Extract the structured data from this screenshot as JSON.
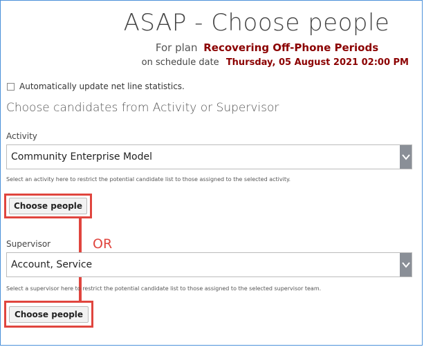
{
  "header": {
    "title": "ASAP - Choose people",
    "plan_prefix": "For plan",
    "plan_name": "Recovering Off-Phone Periods",
    "date_prefix": "on schedule date",
    "date_value": "Thursday, 05 August 2021 02:00 PM"
  },
  "options": {
    "auto_update_label": "Automatically update net line statistics.",
    "auto_update_checked": false
  },
  "main": {
    "section_heading": "Choose candidates from Activity or Supervisor",
    "or_label": "OR",
    "activity": {
      "label": "Activity",
      "selected": "Community Enterprise Model",
      "help": "Select an activity here to restrict the potential candidate list to those assigned to the selected activity.",
      "button": "Choose people"
    },
    "supervisor": {
      "label": "Supervisor",
      "selected": "Account, Service",
      "help": "Select a supervisor here to restrict the potential candidate list to those assigned to the selected supervisor team.",
      "button": "Choose people"
    }
  },
  "colors": {
    "accent_red": "#e0453e",
    "value_red": "#8b0000",
    "frame_blue": "#4a90d9"
  },
  "icons": {
    "dropdown": "chevron-down-icon"
  }
}
